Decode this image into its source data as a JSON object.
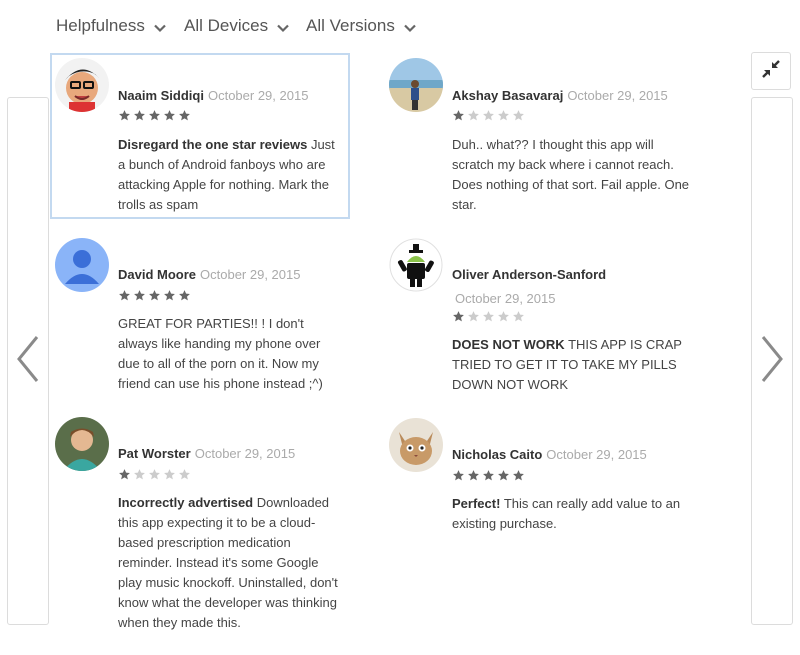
{
  "filters": {
    "sort": "Helpfulness",
    "devices": "All Devices",
    "versions": "All Versions"
  },
  "nav": {
    "prev_icon": "chevron-left-icon",
    "next_icon": "chevron-right-icon",
    "collapse_icon": "collapse-arrows-icon"
  },
  "colors": {
    "star_filled": "#666666",
    "star_empty": "#cccccc",
    "selected_border": "#c3d9f0",
    "date_text": "#aaaaaa"
  },
  "reviews": [
    {
      "author": "Naaim Siddiqi",
      "date": "October 29, 2015",
      "rating": 5,
      "headline": "Disregard the one star reviews",
      "body": "Just a bunch of Android fanboys who are attacking Apple for nothing. Mark the trolls as spam",
      "avatar": "cartoon-face-avatar"
    },
    {
      "author": "Akshay Basavaraj",
      "date": "October 29, 2015",
      "rating": 1,
      "headline": "",
      "body": "Duh.. what?? I thought this app will scratch my back where i cannot reach. Does nothing of that sort. Fail apple. One star.",
      "avatar": "beach-photo-avatar"
    },
    {
      "author": "David Moore",
      "date": "October 29, 2015",
      "rating": 5,
      "headline": "",
      "body": "GREAT FOR PARTIES!! ! I don't always like handing my phone over due to all of the porn on it. Now my friend can use his phone instead ;^)",
      "avatar": "default-person-avatar"
    },
    {
      "author": "Oliver Anderson-Sanford",
      "date": "October 29, 2015",
      "rating": 1,
      "headline": "DOES NOT WORK",
      "body": "THIS APP IS CRAP TRIED TO GET IT TO TAKE MY PILLS DOWN NOT WORK",
      "avatar": "android-robot-avatar"
    },
    {
      "author": "Pat Worster",
      "date": "October 29, 2015",
      "rating": 1,
      "headline": "Incorrectly advertised",
      "body": "Downloaded this app expecting it to be a cloud-based prescription medication reminder. Instead it's some Google play music knockoff. Uninstalled, don't know what the developer was thinking when they made this.",
      "avatar": "person-photo-avatar"
    },
    {
      "author": "Nicholas Caito",
      "date": "October 29, 2015",
      "rating": 5,
      "headline": "Perfect!",
      "body": "This can really add value to an existing purchase.",
      "avatar": "cat-photo-avatar"
    }
  ]
}
